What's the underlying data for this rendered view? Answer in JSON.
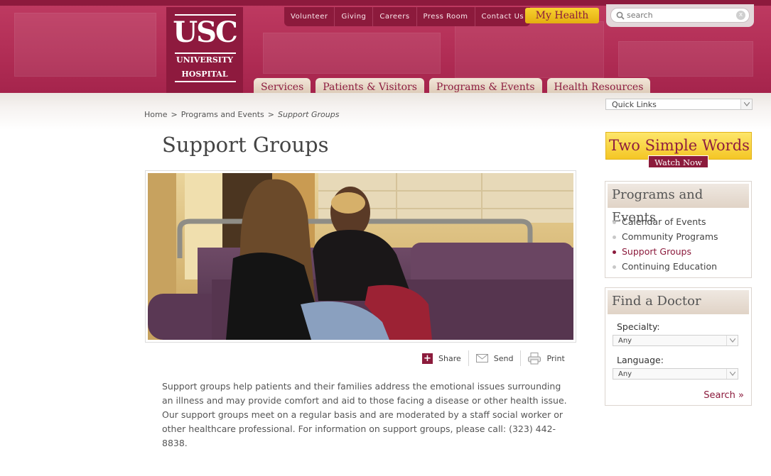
{
  "header": {
    "logo": {
      "main": "USC",
      "line1": "UNIVERSITY",
      "line2": "HOSPITAL"
    },
    "utility_links": [
      "Volunteer",
      "Giving",
      "Careers",
      "Press Room",
      "Contact Us"
    ],
    "my_health_label": "My Health",
    "search": {
      "placeholder": "search",
      "clear_label": "x"
    },
    "main_nav": [
      "Services",
      "Patients & Visitors",
      "Programs & Events",
      "Health Resources"
    ],
    "colors": {
      "brand": "#b22e56",
      "brand_dark": "#8c1a3c",
      "accent_gold": "#f4c625"
    }
  },
  "breadcrumb": {
    "home": "Home",
    "section": "Programs and Events",
    "current": "Support Groups",
    "separator": ">"
  },
  "quick_links": {
    "selected": "Quick Links"
  },
  "main": {
    "title": "Support Groups",
    "share": {
      "share_label": "Share",
      "send_label": "Send",
      "print_label": "Print"
    },
    "body": "Support groups help patients and their families address the emotional issues surrounding an illness and may provide comfort and aid to those facing a disease or other health issue. Our support groups meet on a regular basis and are moderated by a staff social worker or other healthcare professional. For information on support groups, please call: (323) 442-8838."
  },
  "sidebar": {
    "promo": {
      "title": "Two Simple Words",
      "button": "Watch Now"
    },
    "programs": {
      "heading": "Programs and Events",
      "items": [
        {
          "label": "Calendar of Events",
          "active": false
        },
        {
          "label": "Community Programs",
          "active": false
        },
        {
          "label": "Support Groups",
          "active": true
        },
        {
          "label": "Continuing Education",
          "active": false
        }
      ]
    },
    "find_doctor": {
      "heading": "Find a Doctor",
      "specialty_label": "Specialty:",
      "specialty_value": "Any",
      "language_label": "Language:",
      "language_value": "Any",
      "search_label": "Search »"
    }
  }
}
